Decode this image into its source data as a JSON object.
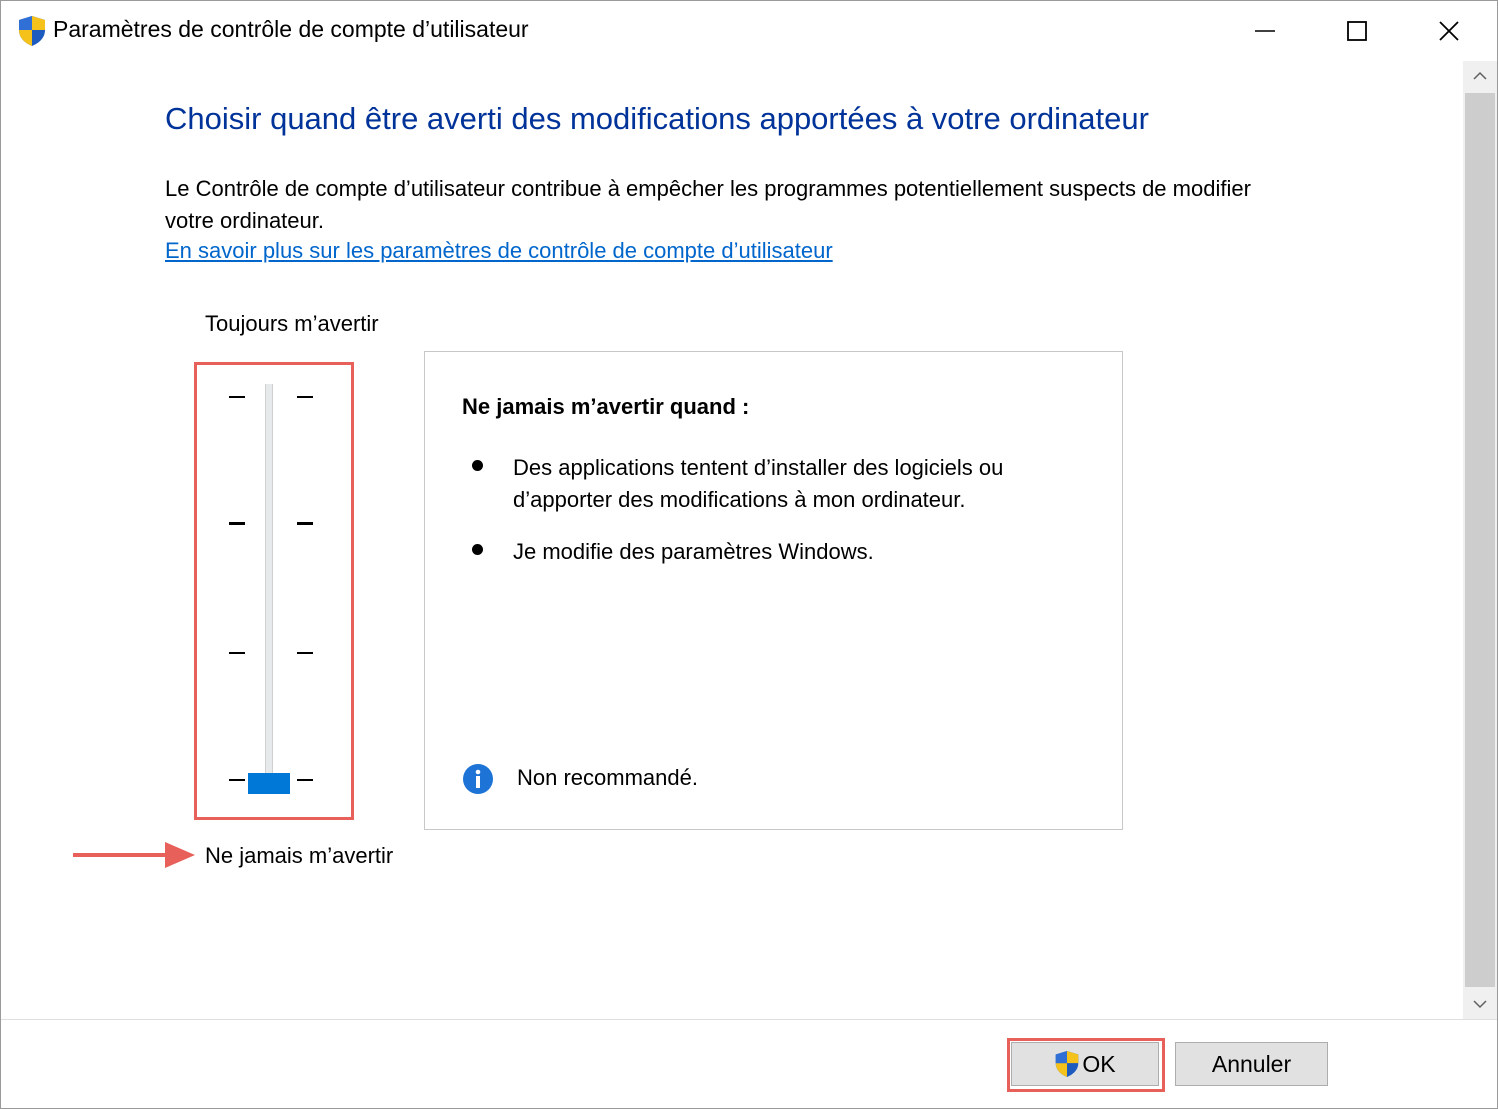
{
  "window": {
    "title": "Paramètres de contrôle de compte d’utilisateur",
    "controls": {
      "minimize_icon": "minimize-icon",
      "maximize_icon": "maximize-icon",
      "close_icon": "close-icon"
    }
  },
  "main": {
    "heading": "Choisir quand être averti des modifications apportées à votre ordinateur",
    "description": "Le Contrôle de compte d’utilisateur contribue à empêcher les programmes potentiellement suspects de modifier votre ordinateur.",
    "learn_more_link": "En savoir plus sur les paramètres de contrôle de compte d’utilisateur"
  },
  "slider": {
    "top_label": "Toujours m’avertir",
    "bottom_label": "Ne jamais m’avertir",
    "levels": 4,
    "selected_level": 1,
    "thumb_color": "#0078d7"
  },
  "info_panel": {
    "title": "Ne jamais m’avertir quand :",
    "items": [
      "Des applications tentent d’installer des logiciels ou d’apporter des modifications à mon ordinateur.",
      "Je modifie des paramètres Windows."
    ],
    "note": "Non recommandé."
  },
  "footer": {
    "ok_label": "OK",
    "cancel_label": "Annuler"
  },
  "colors": {
    "heading": "#003399",
    "link": "#0066cc",
    "highlight": "#e8605a"
  }
}
